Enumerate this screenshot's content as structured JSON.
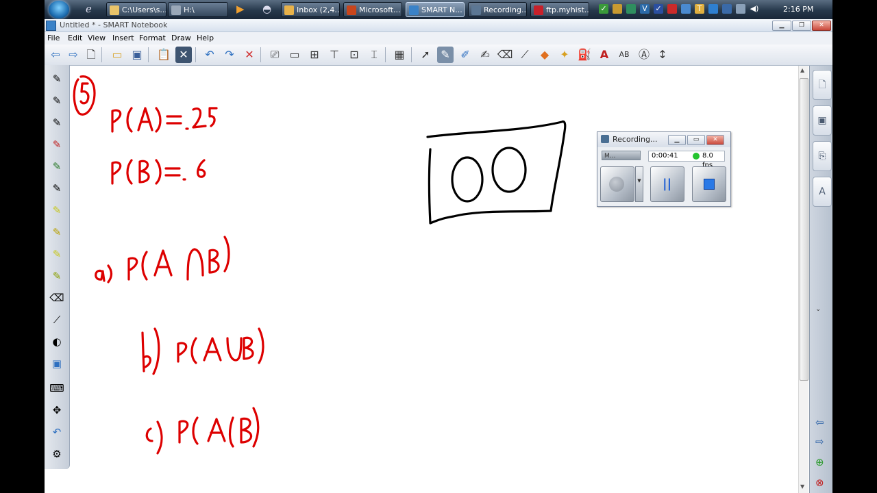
{
  "taskbar": {
    "tasks": [
      {
        "label": "C:\\Users\\s...",
        "icon": "folder-icon",
        "color": "#e9c46a"
      },
      {
        "label": "H:\\",
        "icon": "drive-icon",
        "color": "#9aa8b8"
      },
      {
        "label": "Inbox (2,4...",
        "icon": "mail-icon",
        "color": "#e8b24a"
      },
      {
        "label": "Microsoft...",
        "icon": "powerpoint-icon",
        "color": "#c8451c"
      },
      {
        "label": "SMART N...",
        "icon": "notebook-icon",
        "color": "#3a82c8"
      },
      {
        "label": "Recording...",
        "icon": "recorder-icon",
        "color": "#5c7794"
      },
      {
        "label": "ftp.myhist...",
        "icon": "filezilla-icon",
        "color": "#c8202a"
      }
    ],
    "clock": "2:16 PM"
  },
  "window": {
    "title": "Untitled * - SMART Notebook",
    "menu": [
      "File",
      "Edit",
      "View",
      "Insert",
      "Format",
      "Draw",
      "Help"
    ]
  },
  "toolbar": {
    "tools": [
      "back-arrow-icon",
      "forward-arrow-icon",
      "add-page-icon",
      "open-folder-icon",
      "save-icon",
      "paste-icon",
      "delete-page-icon",
      "undo-icon",
      "redo-icon",
      "delete-icon",
      "screen-shade-icon",
      "full-screen-icon",
      "transparent-icon",
      "display-icon",
      "capture-icon",
      "document-camera-icon",
      "table-icon",
      "select-icon",
      "pen-icon",
      "creative-pen-icon",
      "magic-pen-icon",
      "eraser-icon",
      "line-icon",
      "shapes-icon",
      "magic-wand-icon",
      "fill-icon",
      "text-icon",
      "properties-icon",
      "recognize-icon",
      "move-toolbar-icon"
    ],
    "selected_tool": "pen-icon"
  },
  "canvas": {
    "handwriting": [
      "5",
      "P(A)=.25",
      "P(B)=.6",
      "a) P(A∩B)",
      "b) P(A∪B)",
      "c) P(A|B)"
    ],
    "ink_color": "#dd0000",
    "sketch_color": "#000000"
  },
  "recorder": {
    "title": "Recording...",
    "mic_label": "M...",
    "elapsed": "0:00:41",
    "fps": "8.0 fps",
    "status_color": "#25c42f"
  }
}
